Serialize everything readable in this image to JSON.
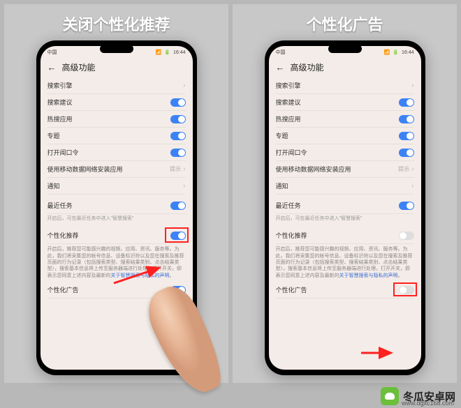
{
  "panelTitles": {
    "left": "关闭个性化推荐",
    "right": "个性化广告"
  },
  "statusbar": {
    "time": "16:44",
    "carrier": "中国"
  },
  "header": {
    "title": "高级功能"
  },
  "rows": {
    "searchEngine": "搜索引擎",
    "searchSuggest": "搜索建议",
    "hotSearch": "热搜应用",
    "special": "专题",
    "openScreen": "打开闻口令",
    "mobileData": "使用移动数据网络安装应用",
    "mobileDataHint": "提示",
    "notification": "通知",
    "recentTasks": "最近任务",
    "recentTasksSub": "开启后，可在最近任务中进入\"智慧搜索\"",
    "personalRec": "个性化推荐",
    "personalRecDesc": "开启后，推荐您可能感兴趣的视频、应用、资讯、服务等。为此，我们将采集您的帐号信息、设备标识符以及您在搜索及推荐页面的行为记录（包括搜索类型、搜索结果类别、点击结果类型），搜索基本信息将上传至服务器端进行处理，打开开关，即表示您同意上述内容及最新的",
    "privacyLink": "关于智慧搜索与隐私的声明",
    "period": "。",
    "personalAds": "个性化广告"
  },
  "watermark": {
    "text": "冬瓜安卓网",
    "url": "www.dgxc168.com"
  }
}
